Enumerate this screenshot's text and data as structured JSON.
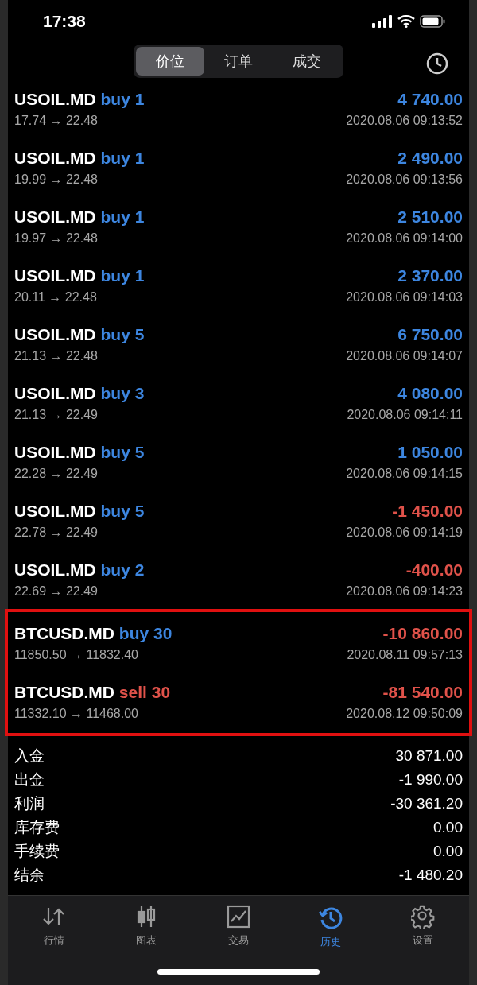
{
  "status_bar": {
    "time": "17:38"
  },
  "segments": [
    {
      "label": "价位",
      "selected": true
    },
    {
      "label": "订单",
      "selected": false
    },
    {
      "label": "成交",
      "selected": false
    }
  ],
  "trades": [
    {
      "symbol": "USOIL.MD",
      "order": "buy 1",
      "kind": "buy",
      "profit": "4 740.00",
      "color": "#3d86e0",
      "prices": "17.74 → 22.48",
      "time": "2020.08.06 09:13:52",
      "highlighted": false
    },
    {
      "symbol": "USOIL.MD",
      "order": "buy 1",
      "kind": "buy",
      "profit": "2 490.00",
      "color": "#3d86e0",
      "prices": "19.99 → 22.48",
      "time": "2020.08.06 09:13:56",
      "highlighted": false
    },
    {
      "symbol": "USOIL.MD",
      "order": "buy 1",
      "kind": "buy",
      "profit": "2 510.00",
      "color": "#3d86e0",
      "prices": "19.97 → 22.48",
      "time": "2020.08.06 09:14:00",
      "highlighted": false
    },
    {
      "symbol": "USOIL.MD",
      "order": "buy 1",
      "kind": "buy",
      "profit": "2 370.00",
      "color": "#3d86e0",
      "prices": "20.11 → 22.48",
      "time": "2020.08.06 09:14:03",
      "highlighted": false
    },
    {
      "symbol": "USOIL.MD",
      "order": "buy 5",
      "kind": "buy",
      "profit": "6 750.00",
      "color": "#3d86e0",
      "prices": "21.13 → 22.48",
      "time": "2020.08.06 09:14:07",
      "highlighted": false
    },
    {
      "symbol": "USOIL.MD",
      "order": "buy 3",
      "kind": "buy",
      "profit": "4 080.00",
      "color": "#3d86e0",
      "prices": "21.13 → 22.49",
      "time": "2020.08.06 09:14:11",
      "highlighted": false
    },
    {
      "symbol": "USOIL.MD",
      "order": "buy 5",
      "kind": "buy",
      "profit": "1 050.00",
      "color": "#3d86e0",
      "prices": "22.28 → 22.49",
      "time": "2020.08.06 09:14:15",
      "highlighted": false
    },
    {
      "symbol": "USOIL.MD",
      "order": "buy 5",
      "kind": "buy",
      "profit": "-1 450.00",
      "color": "#e0524a",
      "prices": "22.78 → 22.49",
      "time": "2020.08.06 09:14:19",
      "highlighted": false
    },
    {
      "symbol": "USOIL.MD",
      "order": "buy 2",
      "kind": "buy",
      "profit": "-400.00",
      "color": "#e0524a",
      "prices": "22.69 → 22.49",
      "time": "2020.08.06 09:14:23",
      "highlighted": false
    },
    {
      "symbol": "BTCUSD.MD",
      "order": "buy 30",
      "kind": "buy",
      "profit": "-10 860.00",
      "color": "#e0524a",
      "prices": "11850.50 → 11832.40",
      "time": "2020.08.11 09:57:13",
      "highlighted": true
    },
    {
      "symbol": "BTCUSD.MD",
      "order": "sell 30",
      "kind": "sell",
      "profit": "-81 540.00",
      "color": "#e0524a",
      "prices": "11332.10 → 11468.00",
      "time": "2020.08.12 09:50:09",
      "highlighted": true
    }
  ],
  "summary": [
    {
      "label": "入金",
      "value": "30 871.00"
    },
    {
      "label": "出金",
      "value": "-1 990.00"
    },
    {
      "label": "利润",
      "value": "-30 361.20"
    },
    {
      "label": "库存费",
      "value": "0.00"
    },
    {
      "label": "手续费",
      "value": "0.00"
    },
    {
      "label": "结余",
      "value": "-1 480.20"
    }
  ],
  "tab_bar": [
    {
      "label": "行情",
      "selected": false
    },
    {
      "label": "图表",
      "selected": false
    },
    {
      "label": "交易",
      "selected": false
    },
    {
      "label": "历史",
      "selected": true
    },
    {
      "label": "设置",
      "selected": false
    }
  ]
}
